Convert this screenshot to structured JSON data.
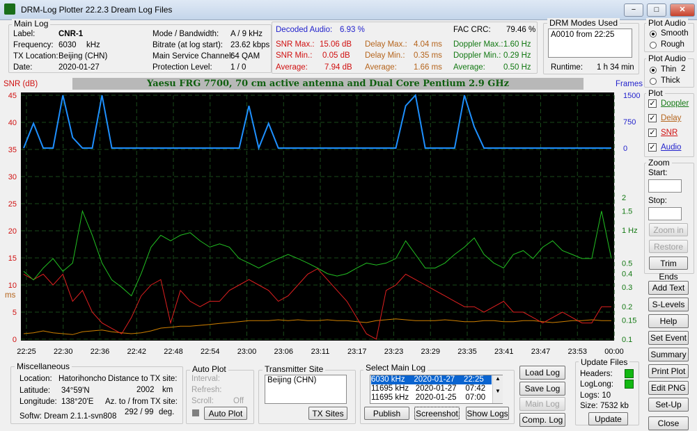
{
  "window": {
    "title": "DRM-Log Plotter 22.2.3   Dream Log Files",
    "min": "−",
    "max": "□",
    "close": "✕"
  },
  "main_log": {
    "legend": "Main Log",
    "label_k": "Label:",
    "label_v": "CNR-1",
    "freq_k": "Frequency:",
    "freq_v": "6030",
    "freq_u": "kHz",
    "tx_k": "TX Location:",
    "tx_v": "Beijing (CHN)",
    "date_k": "Date:",
    "date_v": "2020-01-27",
    "mode_k": "Mode / Bandwidth:",
    "mode_v": "A / 9 kHz",
    "bitrate_k": "Bitrate (at log start):",
    "bitrate_v": "23.62 kbps",
    "msc_k": "Main Service Channel:",
    "msc_v": "64  QAM",
    "prot_k": "Protection Level:",
    "prot_v": "1 / 0"
  },
  "stats": {
    "decoded_k": "Decoded Audio:",
    "decoded_v": "6.93 %",
    "fac_k": "FAC  CRC:",
    "fac_v": "79.46 %",
    "snr_max_k": "SNR Max.:",
    "snr_max_v": "15.06  dB",
    "snr_min_k": "SNR Min.:",
    "snr_min_v": "0.05  dB",
    "snr_avg_k": "Average:",
    "snr_avg_v": "7.94  dB",
    "delay_max_k": "Delay Max.:",
    "delay_max_v": "4.04   ms",
    "delay_min_k": "Delay Min.:",
    "delay_min_v": "0.35   ms",
    "delay_avg_k": "Average:",
    "delay_avg_v": "1.66   ms",
    "dop_max_k": "Doppler Max.:",
    "dop_max_v": "1.60 Hz",
    "dop_min_k": "Doppler Min.:",
    "dop_min_v": "0.29 Hz",
    "dop_avg_k": "Average:",
    "dop_avg_v": "0.50 Hz"
  },
  "drm_modes": {
    "legend": "DRM Modes Used",
    "entry": "A0010 from 22:25",
    "runtime_k": "Runtime:",
    "runtime_v": "1 h 34 min"
  },
  "plot_audio1": {
    "legend": "Plot Audio",
    "smooth": "Smooth",
    "rough": "Rough"
  },
  "plot_audio2": {
    "legend": "Plot Audio",
    "thin": "Thin",
    "thin_n": "2",
    "thick": "Thick"
  },
  "plot": {
    "legend": "Plot",
    "doppler": "Doppler",
    "delay": "Delay",
    "snr": "SNR",
    "audio": "Audio",
    "check": "✓"
  },
  "zoom": {
    "legend": "Zoom",
    "start": "Start:",
    "stop": "Stop:",
    "zoom_in": "Zoom in",
    "restore": "Restore",
    "trim": "Trim Ends"
  },
  "right_buttons": {
    "add_text": "Add Text",
    "s_levels": "S-Levels",
    "help": "Help",
    "set_event": "Set Event",
    "summary": "Summary",
    "print_plot": "Print Plot",
    "edit_png": "Edit PNG",
    "set_up": "Set-Up",
    "close": "Close"
  },
  "chart_data": {
    "type": "line",
    "title": "Yaesu FRG 7700, 70 cm active antenna and Dual Core Pentium 2.9 GHz",
    "left_axis_label": "SNR (dB)",
    "left_axis_unit2": "ms",
    "right_axis_label": "Frames",
    "ylim": [
      0,
      45
    ],
    "y_ticks": [
      0,
      5,
      10,
      15,
      20,
      25,
      30,
      35,
      40,
      45
    ],
    "frames_ticks": [
      "1500",
      "750",
      "0"
    ],
    "doppler_ticks": [
      "2",
      "1.5",
      "1 Hz",
      "0.5",
      "0.4",
      "0.3",
      "0.2",
      "0.15",
      "0.1"
    ],
    "x_ticks": [
      "22:25",
      "22:30",
      "22:36",
      "22:42",
      "22:48",
      "22:54",
      "23:00",
      "23:06",
      "23:11",
      "23:17",
      "23:23",
      "23:29",
      "23:35",
      "23:41",
      "23:47",
      "23:53",
      "00:00"
    ],
    "series": [
      {
        "name": "Audio",
        "color": "#1e90ff",
        "unit": "Frames",
        "values": [
          0,
          700,
          0,
          0,
          1500,
          300,
          0,
          0,
          1500,
          0,
          0,
          0,
          0,
          0,
          0,
          0,
          0,
          0,
          0,
          0,
          0,
          0,
          0,
          1200,
          0,
          700,
          0,
          0,
          0,
          0,
          0,
          0,
          0,
          0,
          0,
          0,
          0,
          0,
          0,
          1200,
          1500,
          0,
          0,
          0,
          0,
          1500,
          600,
          0,
          0,
          0,
          0,
          0,
          0,
          0,
          0,
          0,
          0,
          0,
          0,
          0,
          0
        ]
      },
      {
        "name": "Doppler",
        "color": "#22c022",
        "unit": "Hz",
        "values": [
          0.42,
          0.35,
          0.45,
          0.55,
          0.42,
          0.5,
          1.5,
          0.9,
          0.5,
          0.35,
          0.3,
          0.25,
          0.4,
          0.7,
          0.9,
          0.8,
          0.9,
          0.95,
          0.8,
          0.7,
          0.75,
          0.7,
          0.55,
          0.5,
          0.45,
          0.5,
          0.55,
          0.6,
          0.55,
          0.5,
          0.45,
          0.4,
          0.38,
          0.4,
          0.45,
          0.5,
          0.48,
          0.5,
          0.55,
          0.8,
          0.6,
          0.45,
          0.45,
          0.5,
          0.6,
          0.7,
          0.85,
          0.6,
          0.5,
          0.45,
          0.6,
          0.65,
          0.55,
          0.7,
          0.8,
          0.65,
          0.6,
          0.55,
          0.55,
          1.5,
          0.55
        ]
      },
      {
        "name": "SNR",
        "color": "#e02020",
        "unit": "dB",
        "values": [
          12,
          11,
          12,
          10,
          12,
          7,
          9,
          5,
          3,
          2,
          1,
          4,
          8,
          10,
          11,
          3,
          9,
          7,
          6,
          7,
          7,
          9,
          10,
          11,
          10,
          9,
          7,
          8,
          10,
          12,
          13,
          11,
          9,
          7,
          4,
          1,
          0,
          9,
          10,
          12,
          11,
          10,
          9,
          8,
          7,
          6,
          6,
          5,
          6,
          7,
          5,
          5,
          4,
          3,
          4,
          5,
          4,
          3,
          3,
          6,
          6
        ]
      },
      {
        "name": "Delay",
        "color": "#d08000",
        "unit": "ms",
        "values": [
          0.6,
          0.7,
          0.9,
          0.7,
          0.6,
          0.5,
          0.8,
          0.9,
          1.0,
          0.8,
          0.7,
          0.6,
          0.7,
          0.9,
          1.2,
          1.3,
          1.4,
          1.4,
          1.5,
          1.6,
          1.7,
          1.8,
          1.9,
          2.0,
          2.0,
          2.0,
          2.1,
          2.0,
          2.1,
          2.0,
          2.0,
          2.1,
          2.0,
          2.0,
          1.9,
          1.8,
          2.0,
          2.1,
          2.2,
          2.1,
          2.0,
          2.0,
          2.0,
          2.1,
          2.0,
          1.9,
          1.9,
          2.0,
          2.0,
          1.9,
          1.9,
          2.0,
          2.0,
          1.9,
          1.8,
          1.9,
          2.0,
          2.0,
          2.1,
          2.0,
          2.0
        ]
      }
    ]
  },
  "misc": {
    "legend": "Miscellaneous",
    "loc_k": "Location:",
    "loc_v": "Hatorihoncho",
    "dist_k": "Distance to TX site:",
    "dist_v": "2002",
    "dist_u": "km",
    "lat_k": "Latitude:",
    "lat_v": "34°59'N",
    "lon_k": "Longitude:",
    "lon_v": "138°20'E",
    "az_k": "Az. to / from TX site:",
    "az_v": "292 / 99",
    "az_u": "deg.",
    "softw": "Softw: Dream 2.1.1-svn808"
  },
  "auto_plot": {
    "legend": "Auto Plot",
    "interval": "Interval:",
    "refresh": "Refresh:",
    "scroll": "Scroll:",
    "scroll_v": "Off",
    "button": "Auto Plot"
  },
  "tx_site": {
    "legend": "Transmitter Site",
    "entry": "Beijing (CHN)",
    "button": "TX Sites"
  },
  "select_log": {
    "legend": "Select Main Log",
    "rows": [
      {
        "f": "6030 kHz",
        "d": "2020-01-27",
        "t": "22:25"
      },
      {
        "f": "11695 kHz",
        "d": "2020-01-27",
        "t": "07:42"
      },
      {
        "f": "11695 kHz",
        "d": "2020-01-25",
        "t": "07:00"
      }
    ],
    "publish": "Publish",
    "screenshot": "Screenshot",
    "show_logs": "Show Logs"
  },
  "log_buttons": {
    "load": "Load Log",
    "save": "Save Log",
    "main": "Main Log",
    "comp": "Comp. Log"
  },
  "update_files": {
    "legend": "Update Files",
    "headers": "Headers:",
    "loglong": "LogLong:",
    "logs": "Logs: 10",
    "size": "Size:",
    "size_v": "7532 kb",
    "button": "Update"
  }
}
